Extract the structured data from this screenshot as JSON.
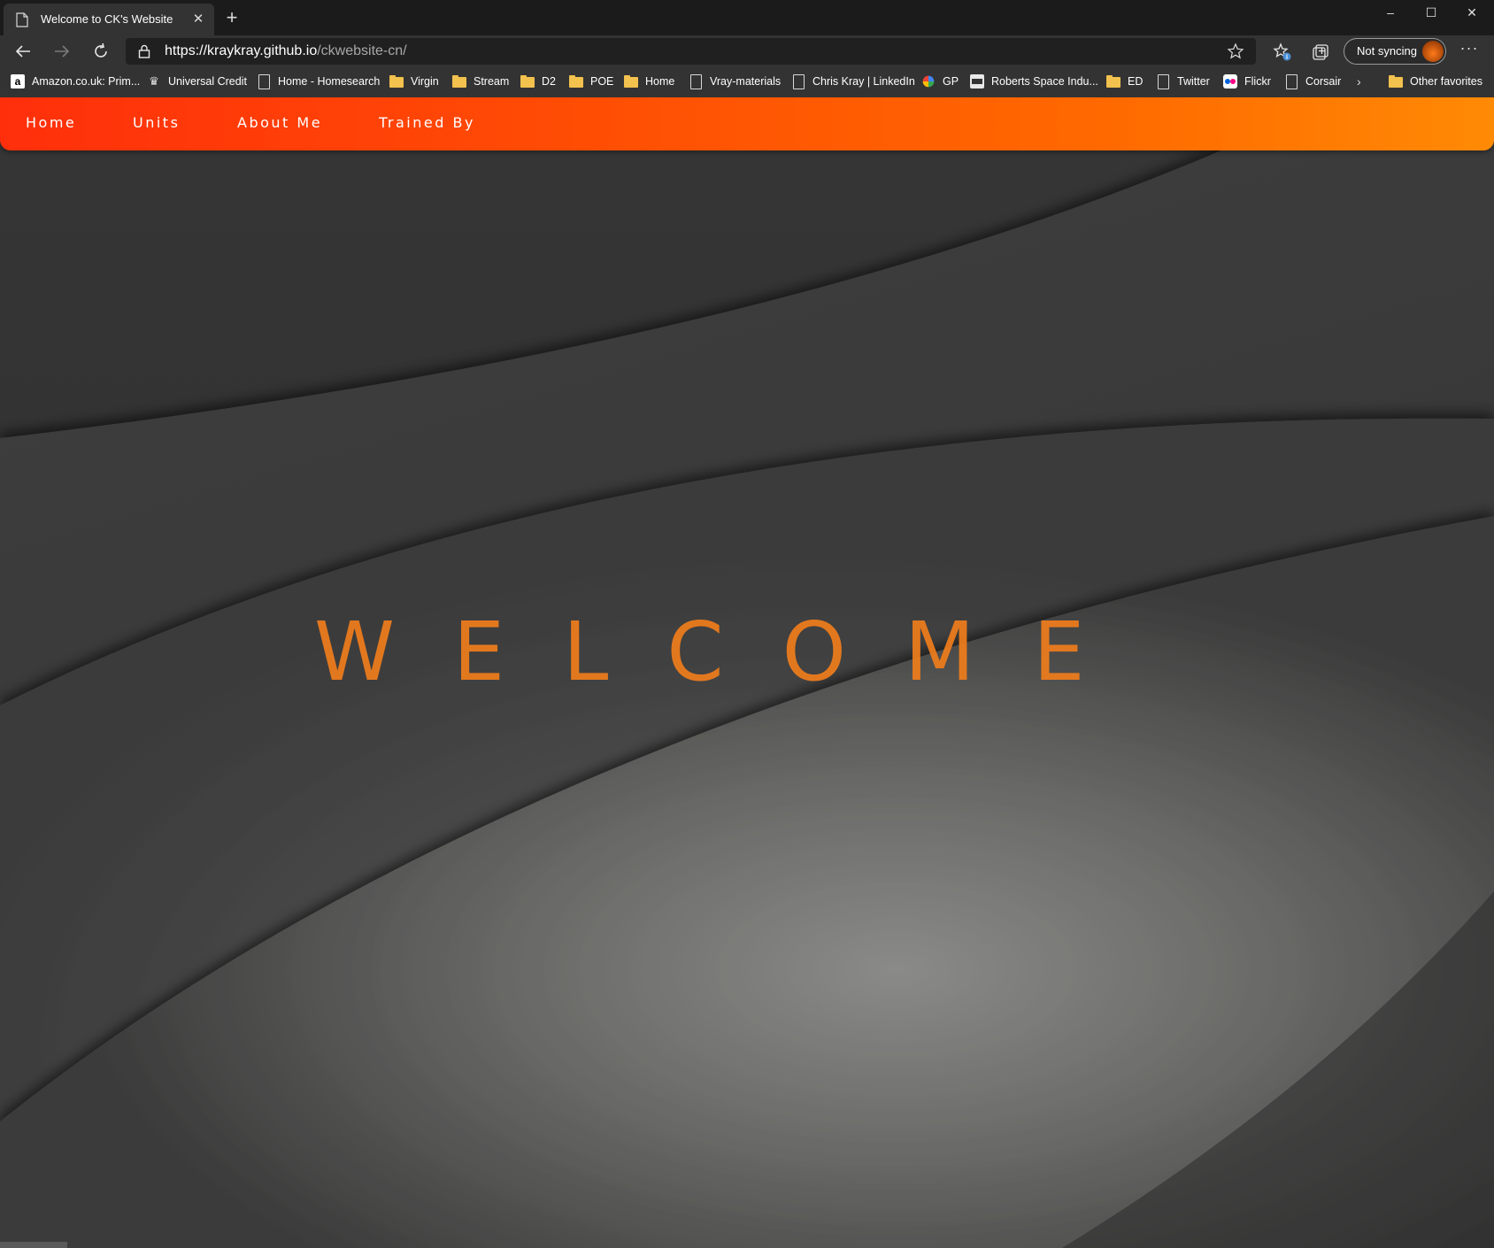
{
  "browser": {
    "tab": {
      "title": "Welcome to CK's Website"
    },
    "address_bar": {
      "host": "https://kraykray.github.io",
      "path": "/ckwebsite-cn/"
    },
    "profile": {
      "label": "Not syncing"
    },
    "bookmarks": [
      {
        "label": "Amazon.co.uk: Prim...",
        "icon": "amazon-icon"
      },
      {
        "label": "Universal Credit",
        "icon": "crown-icon"
      },
      {
        "label": "Home - Homesearch",
        "icon": "page-icon"
      },
      {
        "label": "Virgin",
        "icon": "folder-icon"
      },
      {
        "label": "Stream",
        "icon": "folder-icon"
      },
      {
        "label": "D2",
        "icon": "folder-icon"
      },
      {
        "label": "POE",
        "icon": "folder-icon"
      },
      {
        "label": "Home",
        "icon": "folder-icon"
      },
      {
        "label": "Vray-materials",
        "icon": "page-icon"
      },
      {
        "label": "Chris Kray | LinkedIn",
        "icon": "page-icon"
      },
      {
        "label": "GP",
        "icon": "google-icon"
      },
      {
        "label": "Roberts Space Indu...",
        "icon": "rsi-icon"
      },
      {
        "label": "ED",
        "icon": "folder-icon"
      },
      {
        "label": "Twitter",
        "icon": "page-icon"
      },
      {
        "label": "Flickr",
        "icon": "flickr-icon"
      },
      {
        "label": "Corsair",
        "icon": "page-icon"
      }
    ],
    "other_favorites": "Other favorites"
  },
  "site": {
    "nav": {
      "home": "Home",
      "units": "Units",
      "about": "About Me",
      "trained_by": "Trained By"
    },
    "hero_text": "WELCOME",
    "colors": {
      "nav_gradient_start": "#ff2f0b",
      "nav_gradient_end": "#ff8a05",
      "hero_text": "#f07d1c"
    }
  }
}
